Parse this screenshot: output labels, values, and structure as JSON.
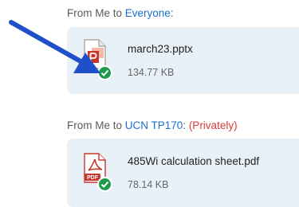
{
  "messages": [
    {
      "from_label": "From Me to ",
      "recipient": "Everyone",
      "suffix": ":",
      "private_note": "",
      "file": {
        "name": "march23.pptx",
        "size": "134.77 KB",
        "type_icon": "powerpoint-file-icon",
        "status_icon": "check-icon"
      }
    },
    {
      "from_label": "From Me to ",
      "recipient": "UCN TP170",
      "suffix": ": ",
      "private_note": "(Privately)",
      "file": {
        "name": "485Wi calculation sheet.pdf",
        "size": "78.14 KB",
        "type_icon": "pdf-file-icon",
        "status_icon": "check-icon"
      }
    }
  ],
  "pdf_badge": "PDF",
  "annotation": {
    "icon": "arrow-annotation-icon",
    "color": "#1f4fc9"
  },
  "colors": {
    "link": "#1a6fd1",
    "private": "#d93a3a",
    "card_bg": "#e9f1f8",
    "success": "#1e9b4a"
  }
}
